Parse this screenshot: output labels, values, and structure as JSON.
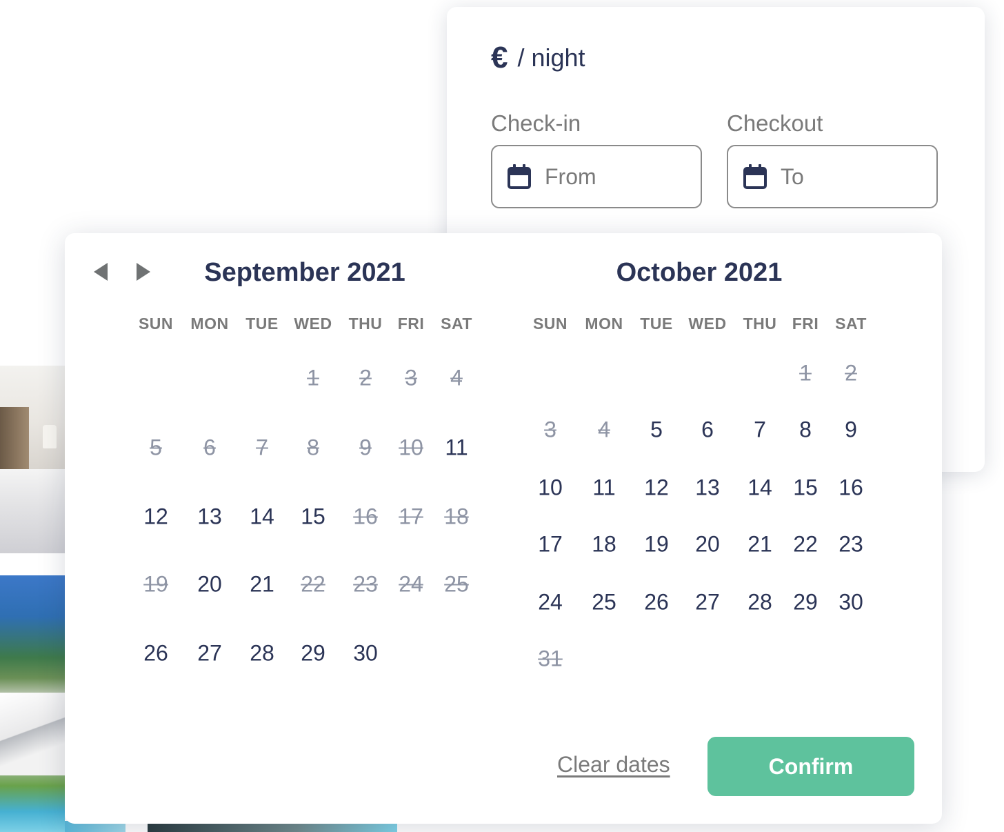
{
  "booking": {
    "price_unit": "/ night",
    "checkin_label": "Check-in",
    "checkout_label": "Checkout",
    "checkin_placeholder": "From",
    "checkout_placeholder": "To"
  },
  "calendar": {
    "weekdays": [
      "SUN",
      "MON",
      "TUE",
      "WED",
      "THU",
      "FRI",
      "SAT"
    ],
    "months": [
      {
        "title": "September 2021",
        "first_weekday": 3,
        "days_in_month": 30,
        "disabled_days": [
          1,
          2,
          3,
          4,
          5,
          6,
          7,
          8,
          9,
          10,
          16,
          17,
          18,
          19,
          22,
          23,
          24,
          25
        ]
      },
      {
        "title": "October 2021",
        "first_weekday": 5,
        "days_in_month": 31,
        "disabled_days": [
          1,
          2,
          3,
          4,
          31
        ]
      }
    ],
    "clear_label": "Clear dates",
    "confirm_label": "Confirm"
  },
  "colors": {
    "text": "#2b3456",
    "muted": "#7a7a7a",
    "disabled_day": "#8e94a4",
    "confirm": "#5ec29d"
  }
}
